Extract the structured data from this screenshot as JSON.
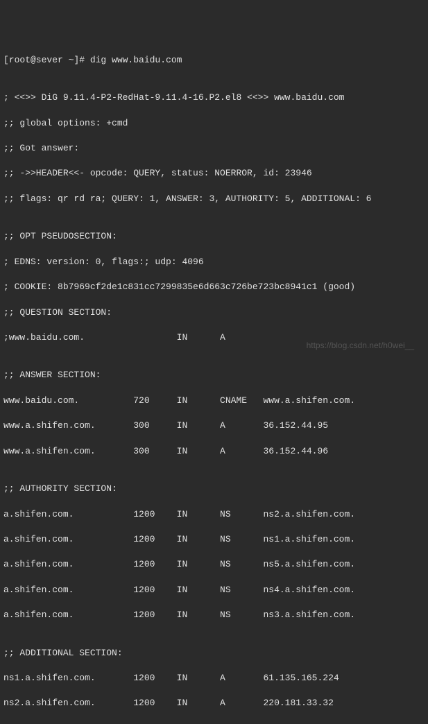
{
  "lines": {
    "l0": "[root@sever ~]# dig www.baidu.com",
    "l1": "",
    "l2": "; <<>> DiG 9.11.4-P2-RedHat-9.11.4-16.P2.el8 <<>> www.baidu.com",
    "l3": ";; global options: +cmd",
    "l4": ";; Got answer:",
    "l5": ";; ->>HEADER<<- opcode: QUERY, status: NOERROR, id: 23946",
    "l6": ";; flags: qr rd ra; QUERY: 1, ANSWER: 3, AUTHORITY: 5, ADDITIONAL: 6",
    "l7": "",
    "l8": ";; OPT PSEUDOSECTION:",
    "l9": "; EDNS: version: 0, flags:; udp: 4096",
    "l10": "; COOKIE: 8b7969cf2de1c831cc7299835e6d663c726be723bc8941c1 (good)",
    "l11": ";; QUESTION SECTION:",
    "l12": ";www.baidu.com.                 IN      A",
    "l13": "",
    "l14": ";; ANSWER SECTION:",
    "l15": "www.baidu.com.          720     IN      CNAME   www.a.shifen.com.",
    "l16": "www.a.shifen.com.       300     IN      A       36.152.44.95",
    "l17": "www.a.shifen.com.       300     IN      A       36.152.44.96",
    "l18": "",
    "l19": ";; AUTHORITY SECTION:",
    "l20": "a.shifen.com.           1200    IN      NS      ns2.a.shifen.com.",
    "l21": "a.shifen.com.           1200    IN      NS      ns1.a.shifen.com.",
    "l22": "a.shifen.com.           1200    IN      NS      ns5.a.shifen.com.",
    "l23": "a.shifen.com.           1200    IN      NS      ns4.a.shifen.com.",
    "l24": "a.shifen.com.           1200    IN      NS      ns3.a.shifen.com.",
    "l25": "",
    "l26": ";; ADDITIONAL SECTION:",
    "l27": "ns1.a.shifen.com.       1200    IN      A       61.135.165.224",
    "l28": "ns2.a.shifen.com.       1200    IN      A       220.181.33.32"
  },
  "watermark": "https://blog.csdn.net/h0wei__"
}
